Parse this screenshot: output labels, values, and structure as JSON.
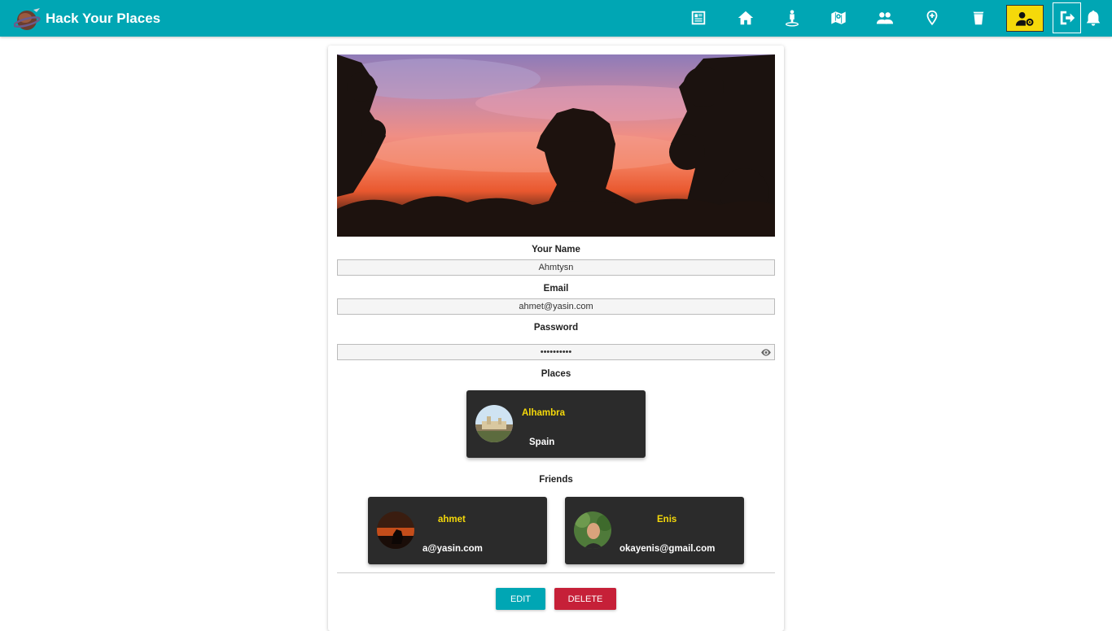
{
  "app": {
    "title": "Hack Your Places"
  },
  "nav": {
    "icons": [
      "newspaper-icon",
      "home-icon",
      "street-view-icon",
      "map-icon",
      "users-icon",
      "map-marker-plus-icon",
      "cup-icon",
      "user-cog-icon",
      "sign-out-icon",
      "bell-icon"
    ]
  },
  "profile": {
    "name_label": "Your Name",
    "name_value": "Ahmtysn",
    "email_label": "Email",
    "email_value": "ahmet@yasin.com",
    "password_label": "Password",
    "password_value": "••••••••••"
  },
  "places": {
    "heading": "Places",
    "items": [
      {
        "title": "Alhambra",
        "subtitle": "Spain"
      }
    ]
  },
  "friends": {
    "heading": "Friends",
    "items": [
      {
        "name": "ahmet",
        "email": "a@yasin.com"
      },
      {
        "name": "Enis",
        "email": "okayenis@gmail.com"
      }
    ]
  },
  "actions": {
    "edit_label": "EDIT",
    "delete_label": "DELETE"
  },
  "colors": {
    "navbar": "#00a6b4",
    "accent_yellow": "#f5d90a",
    "tile_bg": "#2b2b2b",
    "delete_red": "#c62038"
  }
}
